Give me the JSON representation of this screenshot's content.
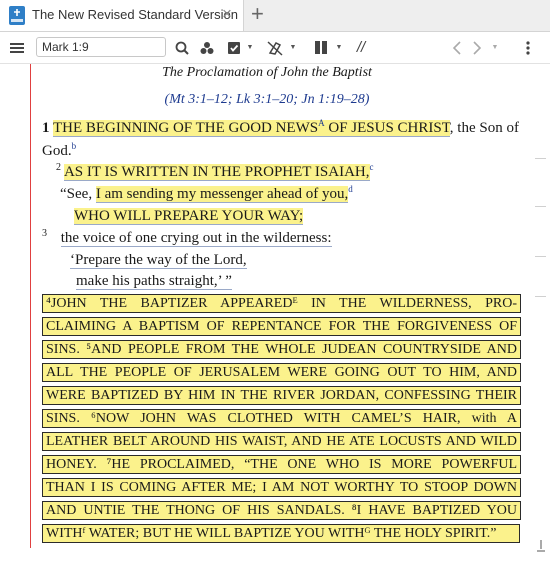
{
  "tab": {
    "title": "The New Revised Standard Version",
    "close": "×",
    "add": "+"
  },
  "toolbar": {
    "reference": "Mark 1:9",
    "parallel": "//"
  },
  "passage": {
    "heading": "The Proclamation of John the Baptist",
    "crossrefs": "(Mt 3:1–12; Lk 3:1–20; Jn 1:19–28)",
    "v1_num": "1",
    "v1_hl": "THE BEGINNING OF THE GOOD NEWS",
    "v1_fn_a": "A",
    "v1_hl2": " OF JESUS CHRIST",
    "v1_rest": ", the Son of",
    "v1_line2": "God.",
    "v1_fn_b": "b",
    "v2_num": "2",
    "v2_text": "AS IT IS WRITTEN IN THE PROPHET ISAIAH,",
    "v2_fn_c": "c",
    "v2_l2a": "“See, ",
    "v2_l2b": "I am sending my messenger ahead of you,",
    "v2_fn_d": "d",
    "v2_l3": "WHO WILL PREPARE YOUR WAY;",
    "v3_num": "3",
    "v3_l1": "the voice of one crying out in the wilderness:",
    "v3_l2": "‘Prepare the way of the Lord,",
    "v3_l3": "make his paths straight,’ ”",
    "box_lines": [
      "⁴JOHN THE BAPTIZER APPEAREDᴱ IN THE WILDERNESS, PRO-",
      "CLAIMING A BAPTISM OF REPENTANCE FOR THE FORGIVENESS OF",
      "SINS. ⁵AND PEOPLE FROM THE WHOLE JUDEAN COUNTRYSIDE AND",
      "ALL THE PEOPLE OF JERUSALEM WERE GOING OUT TO HIM, AND",
      "WERE BAPTIZED BY HIM IN THE RIVER JORDAN, CONFESSING THEIR",
      "SINS. ⁶NOW JOHN WAS CLOTHED WITH CAMEL’S HAIR, with A",
      "LEATHER BELT AROUND HIS WAIST, AND HE ATE LOCUSTS AND WILD",
      "HONEY. ⁷HE PROCLAIMED, “THE ONE WHO IS MORE POWERFUL",
      "THAN I IS COMING AFTER ME; I AM NOT WORTHY TO STOOP DOWN",
      "AND UNTIE THE THONG OF HIS SANDALS. ⁸I HAVE BAPTIZED YOU",
      "WITHᶠ WATER; BUT HE WILL BAPTIZE YOU WITHᴳ THE HOLY SPIRIT.”"
    ]
  },
  "colors": {
    "highlight": "#fbf28c",
    "accent_line": "#e04040",
    "link": "#1d3a8f"
  }
}
